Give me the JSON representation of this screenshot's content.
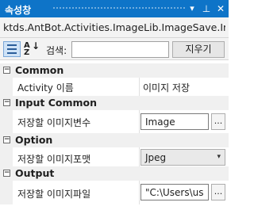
{
  "panel": {
    "title": "속성창",
    "dropdown_glyph": "▾",
    "pin_glyph": "⊥",
    "close_glyph": "✕"
  },
  "object_path": "ktds.AntBot.Activities.ImageLib.ImageSave.Image...",
  "toolbar": {
    "search_label": "검색:",
    "search_value": "",
    "clear_label": "지우기",
    "sort_alpha_top": "A",
    "sort_alpha_bottom": "Z",
    "sort_arrow": "↓"
  },
  "grid": {
    "collapse_glyph": "−",
    "ellipsis_label": "...",
    "dropdown_caret": "▾",
    "categories": [
      {
        "label": "Common",
        "properties": [
          {
            "name": "Activity 이름",
            "value": "이미지 저장",
            "editor": "text"
          }
        ]
      },
      {
        "label": "Input Common",
        "properties": [
          {
            "name": "저장할 이미지변수",
            "value": "Image",
            "editor": "field-ellipsis"
          }
        ]
      },
      {
        "label": "Option",
        "properties": [
          {
            "name": "저장할 이미지포맷",
            "value": "Jpeg",
            "editor": "dropdown"
          }
        ]
      },
      {
        "label": "Output",
        "properties": [
          {
            "name": "저장할 이미지파일",
            "value": "\"C:\\Users\\us",
            "editor": "field-ellipsis"
          }
        ]
      }
    ]
  },
  "colors": {
    "titlebar": "#0e74c8",
    "category_bg": "#f0f0f0"
  }
}
